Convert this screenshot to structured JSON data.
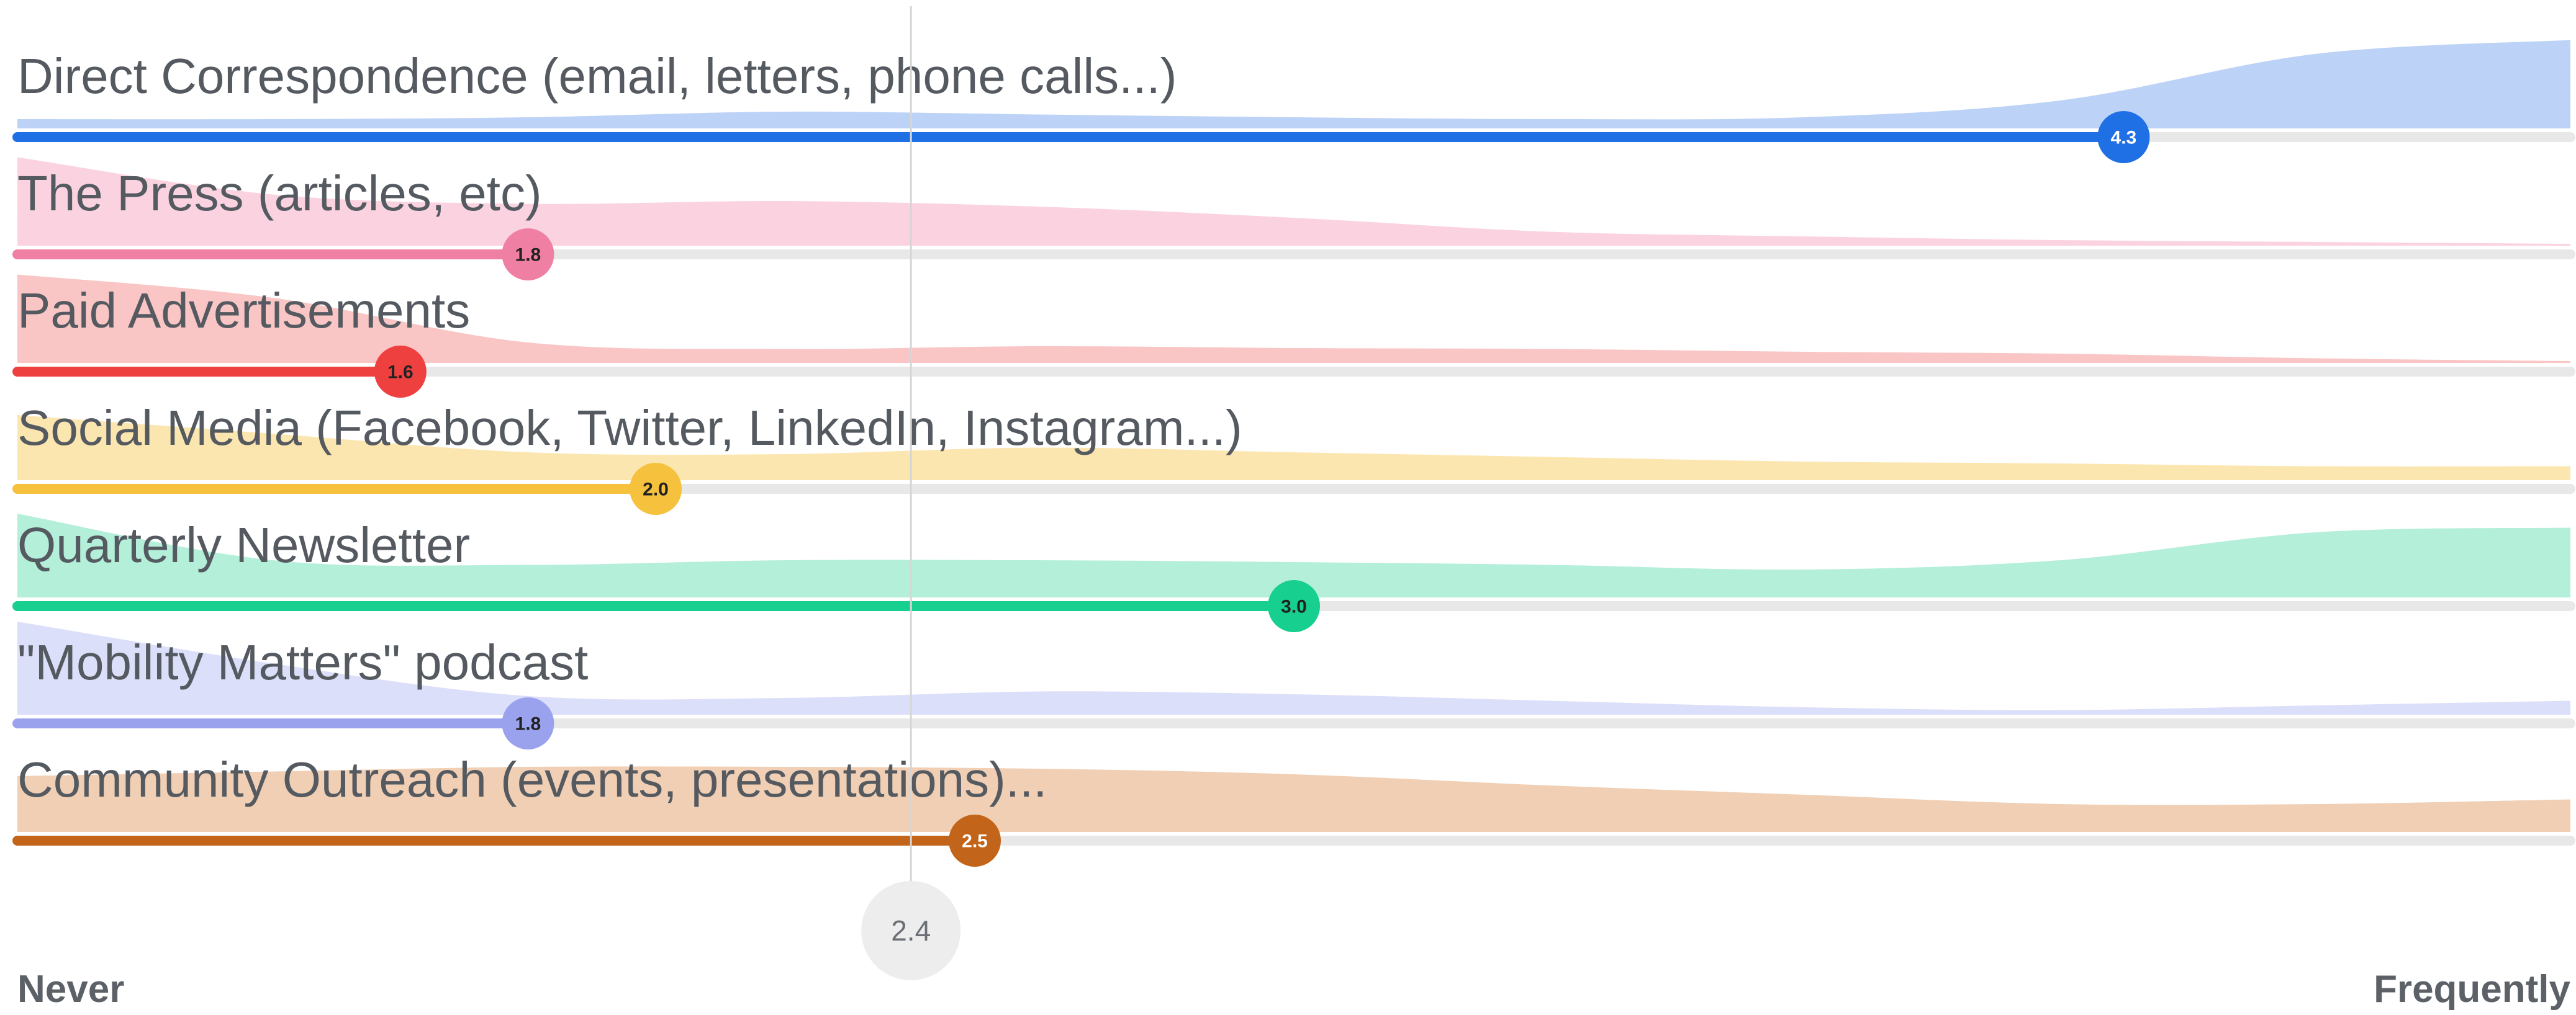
{
  "chart_data": {
    "type": "bar",
    "xlim": [
      1,
      5
    ],
    "axis": {
      "min_label": "Never",
      "max_label": "Frequently"
    },
    "overall_average": {
      "value": 2.4,
      "label": "2.4"
    },
    "rows": [
      {
        "label": "Direct Correspondence (email, letters, phone calls...)",
        "value": 4.3,
        "value_label": "4.3",
        "color": "#1f6fe5",
        "fill_color": "#bcd2f7",
        "text_color": "#ffffff",
        "distribution": [
          0.1,
          0.1,
          0.12,
          0.18,
          0.15,
          0.12,
          0.1,
          0.12,
          0.3,
          0.8,
          0.95
        ]
      },
      {
        "label": "The Press (articles, etc)",
        "value": 1.8,
        "value_label": "1.8",
        "color": "#ef7fa3",
        "fill_color": "#fbd3e0",
        "text_color": "#222222",
        "distribution": [
          0.95,
          0.55,
          0.45,
          0.48,
          0.42,
          0.3,
          0.15,
          0.1,
          0.06,
          0.04,
          0.02
        ]
      },
      {
        "label": "Paid Advertisements",
        "value": 1.6,
        "value_label": "1.6",
        "color": "#ef4040",
        "fill_color": "#fac5c5",
        "text_color": "#222222",
        "distribution": [
          0.95,
          0.7,
          0.22,
          0.15,
          0.18,
          0.16,
          0.15,
          0.12,
          0.1,
          0.05,
          0.02
        ]
      },
      {
        "label": "Social Media (Facebook, Twitter, LinkedIn, Instagram...)",
        "value": 2.0,
        "value_label": "2.0",
        "color": "#f6c23e",
        "fill_color": "#fce6b0",
        "text_color": "#222222",
        "distribution": [
          0.7,
          0.5,
          0.3,
          0.28,
          0.35,
          0.3,
          0.25,
          0.2,
          0.18,
          0.15,
          0.15
        ]
      },
      {
        "label": "Quarterly Newsletter",
        "value": 3.0,
        "value_label": "3.0",
        "color": "#17cf8f",
        "fill_color": "#b3efd9",
        "text_color": "#222222",
        "distribution": [
          0.9,
          0.4,
          0.35,
          0.4,
          0.4,
          0.38,
          0.35,
          0.3,
          0.4,
          0.7,
          0.75
        ]
      },
      {
        "label": "\"Mobility Matters\" podcast",
        "value": 1.8,
        "value_label": "1.8",
        "color": "#9aa2ee",
        "fill_color": "#dcdff9",
        "text_color": "#222222",
        "distribution": [
          1.0,
          0.55,
          0.2,
          0.18,
          0.25,
          0.22,
          0.15,
          0.08,
          0.05,
          0.1,
          0.15
        ]
      },
      {
        "label": "Community Outreach (events, presentations)...",
        "value": 2.5,
        "value_label": "2.5",
        "color": "#c2651a",
        "fill_color": "#f0cfb4",
        "text_color": "#ffffff",
        "distribution": [
          0.6,
          0.65,
          0.7,
          0.7,
          0.68,
          0.62,
          0.5,
          0.4,
          0.3,
          0.3,
          0.35
        ]
      }
    ]
  }
}
